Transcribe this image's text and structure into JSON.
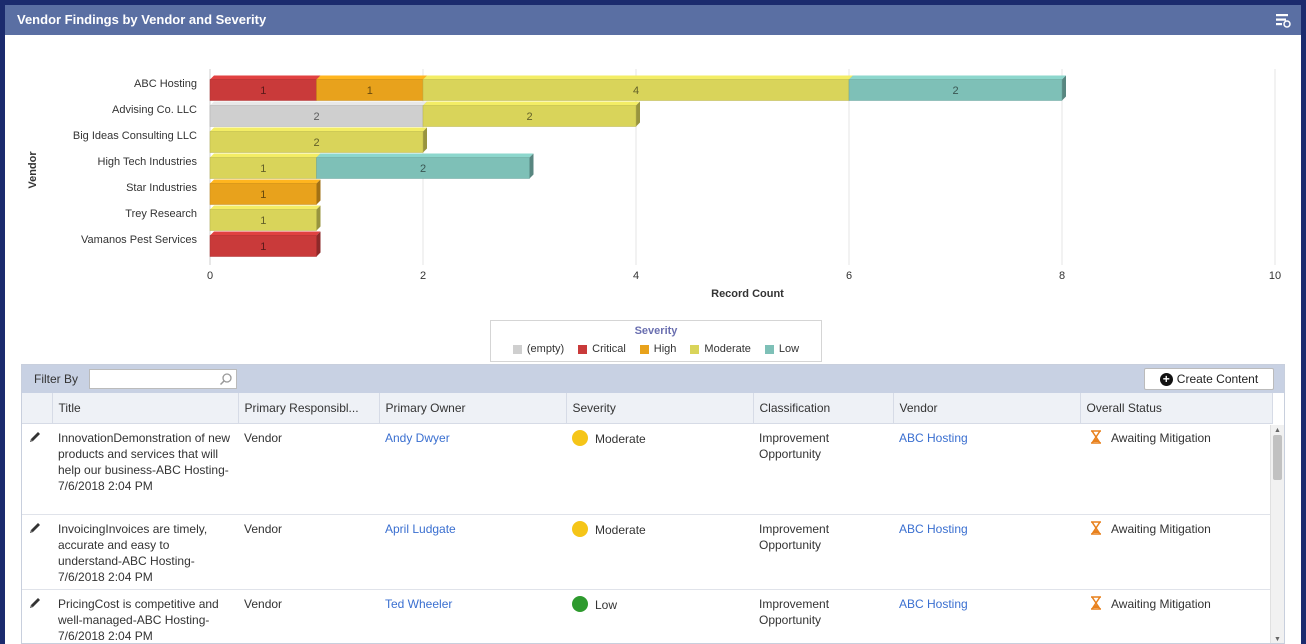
{
  "widget": {
    "title": "Vendor Findings by Vendor and Severity",
    "menu_icon": "settings-menu-icon"
  },
  "colors": {
    "header": "#5a6fa3",
    "page_bg": "#1b2b6e",
    "link": "#3a6fd0",
    "empty": "#cfcfcf",
    "critical": "#c93a3a",
    "high": "#e8a21c",
    "moderate": "#d9d45a",
    "low": "#7ec0b7"
  },
  "chart_data": {
    "type": "bar",
    "orientation": "horizontal",
    "stacked": true,
    "ylabel": "Vendor",
    "xlabel": "Record Count",
    "xlim": [
      0,
      10
    ],
    "xticks": [
      0,
      2,
      4,
      6,
      8,
      10
    ],
    "grid": true,
    "legend_title": "Severity",
    "legend_position": "bottom",
    "categories": [
      "ABC Hosting",
      "Advising Co. LLC",
      "Big Ideas Consulting LLC",
      "High Tech Industries",
      "Star Industries",
      "Trey Research",
      "Vamanos Pest Services"
    ],
    "series": [
      {
        "name": "(empty)",
        "color": "#cfcfcf",
        "values": [
          0,
          2,
          0,
          0,
          0,
          0,
          0
        ]
      },
      {
        "name": "Critical",
        "color": "#c93a3a",
        "values": [
          1,
          0,
          0,
          0,
          0,
          0,
          1
        ]
      },
      {
        "name": "High",
        "color": "#e8a21c",
        "values": [
          1,
          0,
          0,
          0,
          1,
          0,
          0
        ]
      },
      {
        "name": "Moderate",
        "color": "#d9d45a",
        "values": [
          4,
          2,
          2,
          1,
          0,
          1,
          0
        ]
      },
      {
        "name": "Low",
        "color": "#7ec0b7",
        "values": [
          2,
          0,
          0,
          2,
          0,
          0,
          0
        ]
      }
    ]
  },
  "toolbar": {
    "filter_label": "Filter By",
    "filter_value": "",
    "filter_placeholder": "",
    "create_label": "Create Content"
  },
  "table": {
    "columns": [
      "Title",
      "Primary Responsibl...",
      "Primary Owner",
      "Severity",
      "Classification",
      "Vendor",
      "Overall Status"
    ],
    "rows": [
      {
        "title": "InnovationDemonstration of new products and services that will help our business-ABC Hosting-7/6/2018 2:04 PM",
        "responsibility": "Vendor",
        "owner": "Andy Dwyer",
        "severity": "Moderate",
        "severity_color": "#f5c518",
        "classification": "Improvement Opportunity",
        "vendor": "ABC Hosting",
        "status": "Awaiting Mitigation"
      },
      {
        "title": "InvoicingInvoices are timely, accurate and easy to understand-ABC Hosting-7/6/2018 2:04 PM",
        "responsibility": "Vendor",
        "owner": "April Ludgate",
        "severity": "Moderate",
        "severity_color": "#f5c518",
        "classification": "Improvement Opportunity",
        "vendor": "ABC Hosting",
        "status": "Awaiting Mitigation"
      },
      {
        "title": "PricingCost is competitive and well-managed-ABC Hosting-7/6/2018 2:04 PM",
        "responsibility": "Vendor",
        "owner": "Ted Wheeler",
        "severity": "Low",
        "severity_color": "#2e9a2e",
        "classification": "Improvement Opportunity",
        "vendor": "ABC Hosting",
        "status": "Awaiting Mitigation"
      }
    ]
  }
}
